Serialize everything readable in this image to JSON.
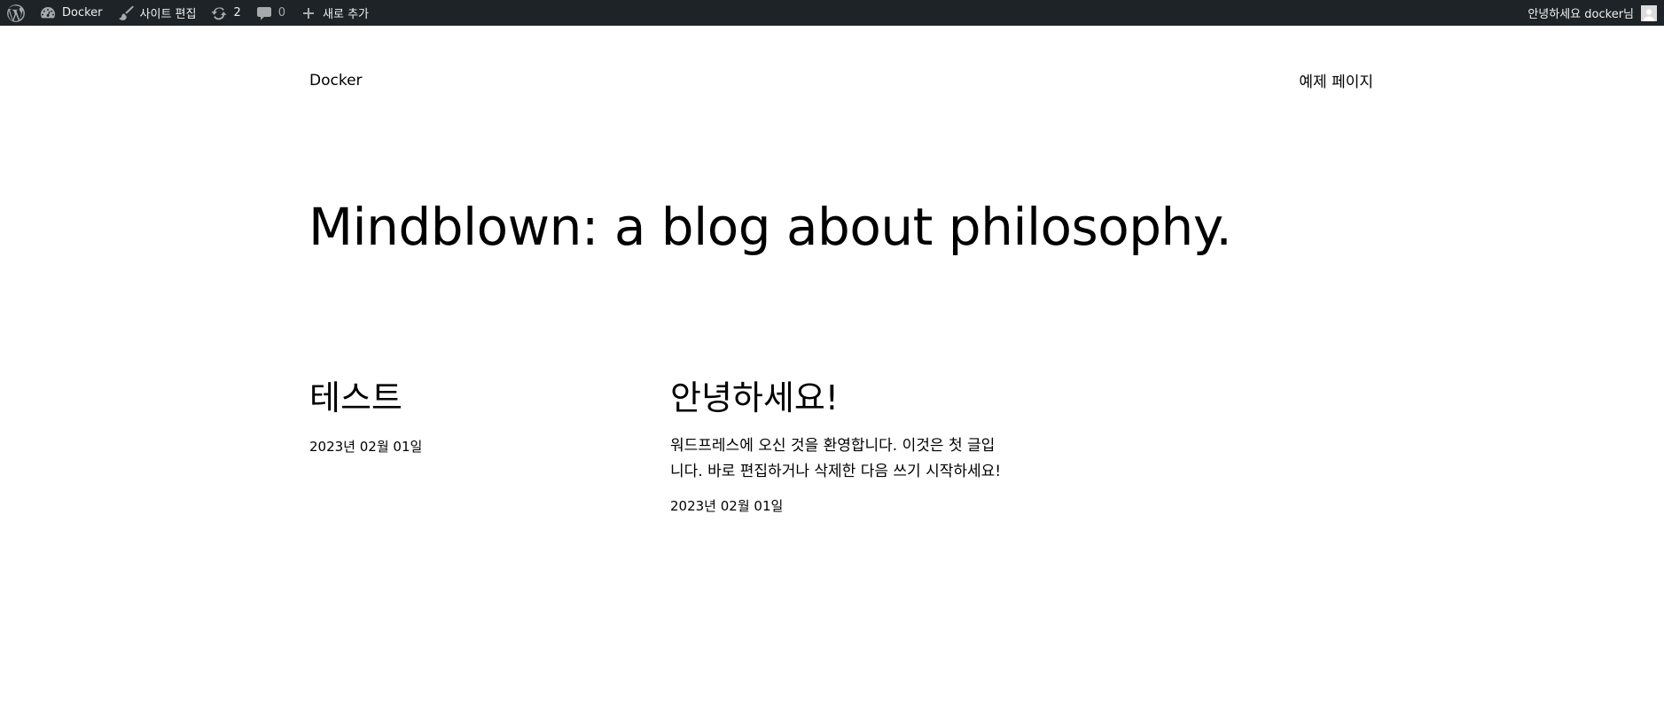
{
  "adminbar": {
    "wp_logo_icon": "wordpress-logo-icon",
    "site_name": "Docker",
    "site_edit_label": "사이트 편집",
    "updates_count": "2",
    "comments_count": "0",
    "new_label": "새로 추가",
    "greeting": "안녕하세요 docker님"
  },
  "header": {
    "site_title": "Docker",
    "nav_item": "예제 페이지"
  },
  "tagline": "Mindblown: a blog about philosophy.",
  "posts": [
    {
      "title": "테스트",
      "excerpt": "",
      "date": "2023년 02월 01일"
    },
    {
      "title": "안녕하세요!",
      "excerpt": "워드프레스에 오신 것을 환영합니다. 이것은 첫 글입니다. 바로 편집하거나 삭제한 다음 쓰기 시작하세요!",
      "date": "2023년 02월 01일"
    }
  ],
  "colors": {
    "adminbar_bg": "#1d2327",
    "adminbar_text": "#f0f0f1",
    "page_bg": "#ffffff"
  }
}
